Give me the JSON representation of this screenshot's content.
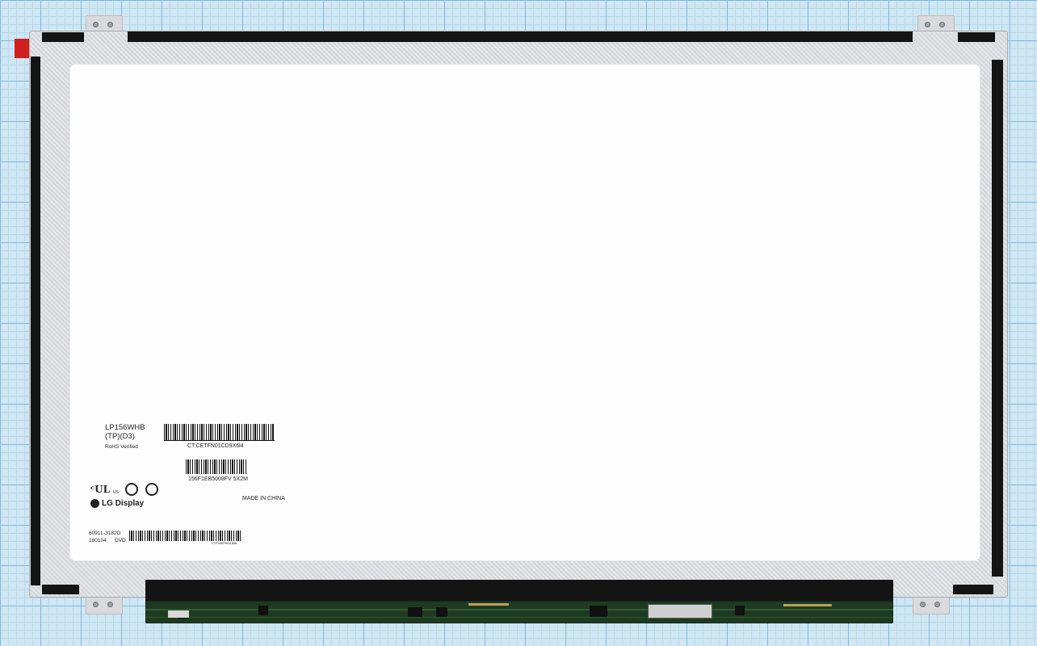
{
  "label": {
    "model": "LP156WHB",
    "model_variant": "(TP)(D3)",
    "rohs": "RoHS Verified",
    "barcode1_text": "CT:CETFN01CD9X6l4",
    "barcode2_text": "156F1EB5008FV  5X2M",
    "made_in": "MADE IN CHINA",
    "brand": "LG Display",
    "ul_mark": "US",
    "part_number": "6091L-3182D",
    "date_code": "180104",
    "lot_code": "DVD",
    "small_print": "CT:FN0EP5E01B5B"
  },
  "colors": {
    "grid_background": "#cfe6f3",
    "frame": "#d9dbde",
    "screen": "#fefefe",
    "pcb": "#1f3a22",
    "red_tab": "#d21f1f"
  }
}
